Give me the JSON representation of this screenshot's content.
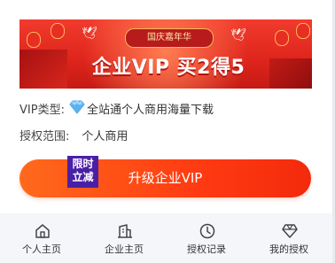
{
  "banner": {
    "ribbon": "国庆嘉年华",
    "headline": "企业VIP 买2得5"
  },
  "vip_type": {
    "label": "VIP类型:",
    "value": "全站通个人商用海量下载",
    "icon": "diamond-icon"
  },
  "license_scope": {
    "label": "授权范围:",
    "value": "个人商用"
  },
  "upgrade": {
    "badge_line1": "限时",
    "badge_line2": "立减",
    "label": "升级企业VIP"
  },
  "nav": {
    "items": [
      {
        "label": "个人主页",
        "icon": "home-icon"
      },
      {
        "label": "企业主页",
        "icon": "building-icon"
      },
      {
        "label": "授权记录",
        "icon": "clock-icon"
      },
      {
        "label": "我的授权",
        "icon": "diamond-icon"
      }
    ]
  },
  "colors": {
    "accent": "#ff4a14",
    "badge": "#4a1fa6",
    "banner_red": "#e0261d"
  }
}
